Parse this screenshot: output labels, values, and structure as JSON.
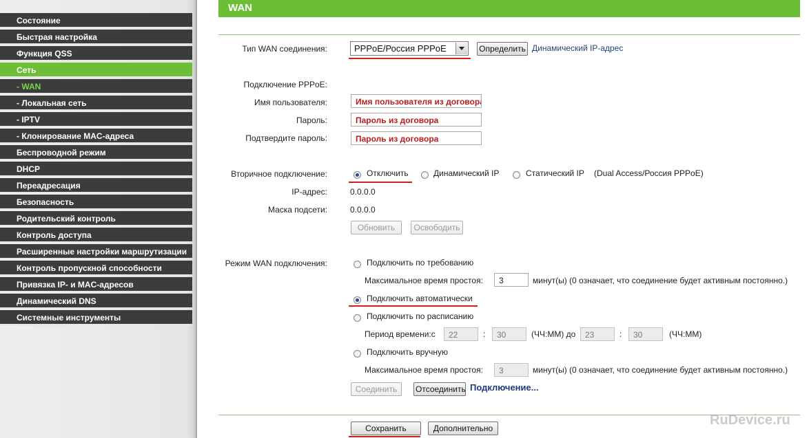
{
  "sidebar": {
    "items": [
      {
        "label": "Состояние"
      },
      {
        "label": "Быстрая настройка"
      },
      {
        "label": "Функция QSS"
      },
      {
        "label": "Сеть"
      },
      {
        "label": "- WAN"
      },
      {
        "label": "- Локальная сеть"
      },
      {
        "label": "- IPTV"
      },
      {
        "label": "- Клонирование MAC-адреса"
      },
      {
        "label": "Беспроводной режим"
      },
      {
        "label": "DHCP"
      },
      {
        "label": "Переадресация"
      },
      {
        "label": "Безопасность"
      },
      {
        "label": "Родительский контроль"
      },
      {
        "label": "Контроль доступа"
      },
      {
        "label": "Расширенные настройки маршрутизации"
      },
      {
        "label": "Контроль пропускной способности"
      },
      {
        "label": "Привязка IP- и MAC-адресов"
      },
      {
        "label": "Динамический DNS"
      },
      {
        "label": "Системные инструменты"
      }
    ],
    "active_item": "Сеть",
    "active_subitem": "- WAN"
  },
  "header": {
    "title": "WAN"
  },
  "wan_type": {
    "label": "Тип WAN соединения:",
    "selected": "PPPoE/Россия PPPoE",
    "detect_button": "Определить",
    "hint": "Динамический IP-адрес"
  },
  "pppoe": {
    "section_label": "Подключение PPPoE:",
    "username_label": "Имя пользователя:",
    "username_value": "Имя пользователя из договора",
    "password_label": "Пароль:",
    "password_value": "Пароль из договора",
    "confirm_label": "Подтвердите пароль:",
    "confirm_value": "Пароль из договора"
  },
  "secondary": {
    "label": "Вторичное подключение:",
    "options": [
      "Отключить",
      "Динамический IP",
      "Статический IP"
    ],
    "selected": "Отключить",
    "note": "(Dual Access/Россия PPPoE)",
    "ip_label": "IP-адрес:",
    "ip_value": "0.0.0.0",
    "mask_label": "Маска подсети:",
    "mask_value": "0.0.0.0",
    "renew_button": "Обновить",
    "release_button": "Освободить"
  },
  "wan_mode": {
    "label": "Режим WAN подключения:",
    "on_demand": "Подключить по требованию",
    "idle_label_1": "Максимальное время простоя:",
    "idle_value_1": "3",
    "idle_note_1": "минут(ы) (0 означает, что соединение будет активным постоянно.)",
    "auto": "Подключить автоматически",
    "schedule": "Подключить по расписанию",
    "period_label": "Период времени:с",
    "period_from_h": "22",
    "period_colon_1": ":",
    "period_from_m": "30",
    "period_mid": "(ЧЧ:ММ) до",
    "period_to_h": "23",
    "period_colon_2": ":",
    "period_to_m": "30",
    "period_end": "(ЧЧ:ММ)",
    "manual": "Подключить вручную",
    "idle_label_2": "Максимальное время простоя:",
    "idle_value_2": "3",
    "idle_note_2": "минут(ы) (0 означает, что соединение будет активным постоянно.)",
    "selected": "Подключить автоматически",
    "connect_button": "Соединить",
    "disconnect_button": "Отсоединить",
    "status_link": "Подключение..."
  },
  "footer": {
    "save_button": "Сохранить",
    "advanced_button": "Дополнительно"
  },
  "watermark": "RuDevice.ru",
  "colors": {
    "accent_green": "#6dbd36",
    "sidebar_dark": "#3c3c3c",
    "highlight_red": "#d11f1f",
    "field_text_red": "#b81c1c"
  }
}
